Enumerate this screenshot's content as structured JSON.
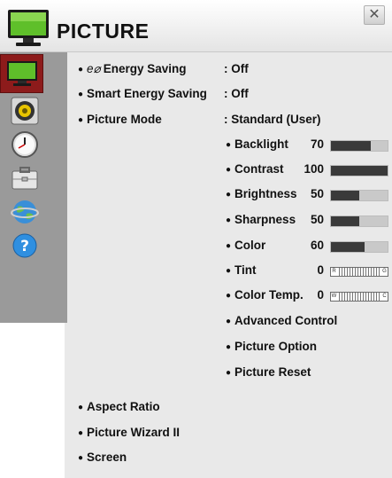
{
  "header": {
    "title": "PICTURE",
    "close_label": "✕"
  },
  "sidebar": {
    "items": [
      {
        "name": "picture-category-icon",
        "active": true
      },
      {
        "name": "audio-category-icon",
        "active": false
      },
      {
        "name": "time-category-icon",
        "active": false
      },
      {
        "name": "option-category-icon",
        "active": false
      },
      {
        "name": "network-category-icon",
        "active": false
      },
      {
        "name": "support-category-icon",
        "active": false
      }
    ]
  },
  "menu": {
    "energy_saving": {
      "eco_symbol": "e⌀",
      "label": "Energy Saving",
      "value": ": Off"
    },
    "smart_energy_saving": {
      "label": "Smart Energy Saving",
      "value": ": Off"
    },
    "picture_mode": {
      "label": "Picture Mode",
      "value": ": Standard (User)"
    },
    "backlight": {
      "label": "Backlight",
      "value": "70",
      "level": 70
    },
    "contrast": {
      "label": "Contrast",
      "value": "100",
      "level": 100
    },
    "brightness": {
      "label": "Brightness",
      "value": "50",
      "level": 50
    },
    "sharpness": {
      "label": "Sharpness",
      "value": "50",
      "level": 50
    },
    "color": {
      "label": "Color",
      "value": "60",
      "level": 60
    },
    "tint": {
      "label": "Tint",
      "value": "0",
      "left_cap": "R",
      "right_cap": "G"
    },
    "color_temp": {
      "label": "Color Temp.",
      "value": "0",
      "left_cap": "W",
      "right_cap": "C"
    },
    "advanced_control": {
      "label": "Advanced Control"
    },
    "picture_option": {
      "label": "Picture Option"
    },
    "picture_reset": {
      "label": "Picture Reset"
    },
    "aspect_ratio": {
      "label": "Aspect Ratio"
    },
    "picture_wizard": {
      "label": "Picture Wizard II"
    },
    "screen": {
      "label": "Screen"
    }
  },
  "colors": {
    "accent": "#8d1b1b",
    "bar_fill": "#3a3a3a",
    "bar_track": "#c9c9c9",
    "sidebar": "#9a9a9a"
  }
}
